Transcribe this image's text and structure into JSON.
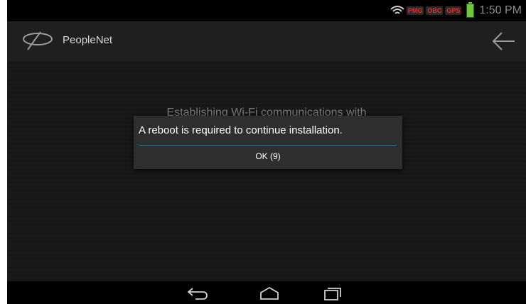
{
  "status_bar": {
    "time": "1:50 PM",
    "indicators": [
      "PMG",
      "OBC",
      "GPS"
    ],
    "icons": [
      "wifi-icon",
      "battery-icon"
    ],
    "battery_color": "#6ec83a",
    "indicator_color": "#e03030"
  },
  "action_bar": {
    "title": "PeopleNet",
    "icons": [
      "peoplenet-logo",
      "back-arrow-icon"
    ]
  },
  "content": {
    "background_text": "Establishing Wi-Fi communications with"
  },
  "dialog": {
    "message": "A reboot is required to continue installation.",
    "ok_label": "OK (9)",
    "divider_color": "#3d6f82"
  },
  "navigation_bar": {
    "icons": [
      "back-nav-icon",
      "home-nav-icon",
      "recents-nav-icon"
    ]
  }
}
